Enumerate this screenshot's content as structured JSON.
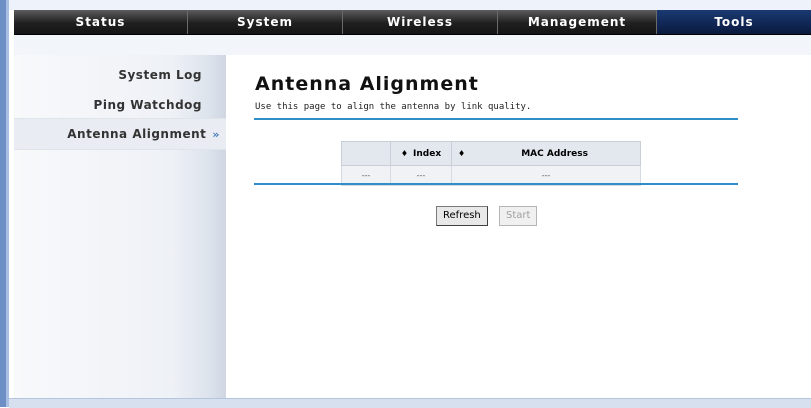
{
  "nav": {
    "items": [
      {
        "label": "Status"
      },
      {
        "label": "System"
      },
      {
        "label": "Wireless"
      },
      {
        "label": "Management"
      },
      {
        "label": "Tools"
      }
    ],
    "active": "Tools"
  },
  "sidebar": {
    "items": [
      {
        "label": "System Log"
      },
      {
        "label": "Ping Watchdog"
      },
      {
        "label": "Antenna Alignment"
      }
    ],
    "active_arrow": "»"
  },
  "main": {
    "title": "Antenna Alignment",
    "description": "Use this page to align the antenna by link quality.",
    "table": {
      "headers": [
        "",
        "Index",
        "MAC Address"
      ],
      "rows": [
        [
          "---",
          "---",
          "---"
        ]
      ]
    },
    "refresh_label": "Refresh",
    "start_label": "Start"
  },
  "colors": {
    "accent_rule": "#2f8dc8",
    "nav_active": "#102654",
    "nav_bg": "#1f1f1f"
  }
}
